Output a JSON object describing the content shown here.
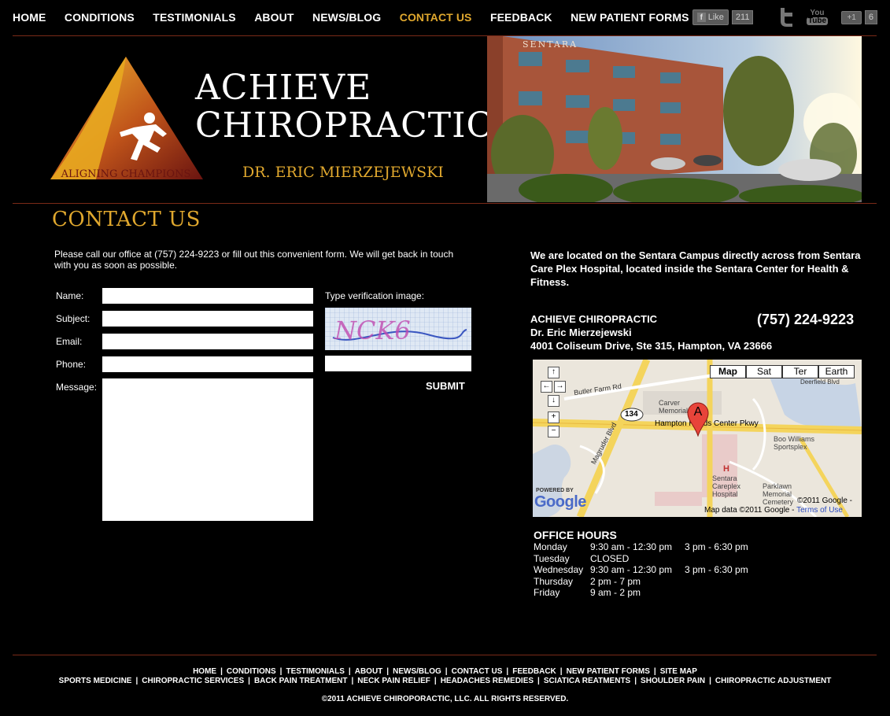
{
  "nav": {
    "items": [
      "HOME",
      "CONDITIONS",
      "TESTIMONIALS",
      "ABOUT",
      "NEWS/BLOG",
      "CONTACT US",
      "FEEDBACK",
      "NEW PATIENT FORMS"
    ],
    "active": "CONTACT US"
  },
  "social": {
    "fb_like_label": "Like",
    "fb_count": "211",
    "youtube_you": "You",
    "youtube_tube": "Tube",
    "gplus_label": "+1",
    "gplus_count": "6"
  },
  "header": {
    "logo_tagline": "ALIGNING CHAMPIONS",
    "title_line1": "ACHIEVE",
    "title_line2": "CHIROPRACTIC",
    "doctor": "DR. ERIC MIERZEJEWSKI",
    "hero_sign": "SENTARA"
  },
  "contact": {
    "page_title": "CONTACT US",
    "intro": "Please call our office at (757) 224-9223 or fill out this convenient form. We will get back in touch with you as soon as possible.",
    "labels": {
      "name": "Name:",
      "subject": "Subject:",
      "email": "Email:",
      "phone": "Phone:",
      "message": "Message:",
      "verify": "Type verification image:"
    },
    "captcha_text": "NCK6",
    "submit": "SUBMIT"
  },
  "location": {
    "text": "We are located on the Sentara Campus directly across from Sentara Care Plex Hospital, located inside the Sentara Center for Health & Fitness.",
    "practice": "ACHIEVE CHIROPRACTIC",
    "doctor": "Dr. Eric Mierzejewski",
    "address": "4001 Coliseum Drive, Ste 315, Hampton, VA 23666",
    "phone": "(757) 224-9223"
  },
  "map": {
    "types": [
      "Map",
      "Sat",
      "Ter",
      "Earth"
    ],
    "selected": "Map",
    "labels": {
      "butler": "Butler Farm Rd",
      "route": "134",
      "hampton_pkwy": "Hampton Roads Center Pkwy",
      "carver": "Carver Memorial",
      "boo": "Boo Williams Sportsplex",
      "sentara": "Sentara Careplex Hospital",
      "parklawn": "Parklawn Memorial Cemetery",
      "magruder": "Magruder Blvd",
      "deerfield": "Deerfield Blvd",
      "marker": "A",
      "powered": "POWERED BY",
      "google": "Google",
      "copyright1": "©2011 Google -",
      "mapdata": "Map data ©2011 Google -",
      "terms": "Terms of Use",
      "hospital_h": "H"
    }
  },
  "hours": {
    "title": "OFFICE HOURS",
    "rows": [
      {
        "day": "Monday",
        "s1": "9:30 am - 12:30 pm",
        "s2": "3 pm - 6:30 pm"
      },
      {
        "day": "Tuesday",
        "s1": "CLOSED",
        "s2": ""
      },
      {
        "day": "Wednesday",
        "s1": "9:30 am - 12:30 pm",
        "s2": "3 pm - 6:30 pm"
      },
      {
        "day": "Thursday",
        "s1": "2 pm - 7 pm",
        "s2": ""
      },
      {
        "day": "Friday",
        "s1": "9 am - 2 pm",
        "s2": ""
      }
    ]
  },
  "footer": {
    "line1": [
      "HOME",
      "CONDITIONS",
      "TESTIMONIALS",
      "ABOUT",
      "NEWS/BLOG",
      "CONTACT US",
      "FEEDBACK",
      "NEW PATIENT FORMS",
      "SITE MAP"
    ],
    "line2": [
      "SPORTS MEDICINE",
      "CHIROPRACTIC SERVICES",
      "BACK PAIN TREATMENT",
      "NECK PAIN RELIEF",
      "HEADACHES REMEDIES",
      "SCIATICA REATMENTS",
      "SHOULDER PAIN",
      "CHIROPRACTIC ADJUSTMENT"
    ],
    "copyright": "©2011 ACHIEVE CHIROPORACTIC, LLC. ALL RIGHTS RESERVED."
  },
  "colors": {
    "accent": "#e0a82e",
    "rule": "#7a2a18",
    "background": "#000000"
  }
}
